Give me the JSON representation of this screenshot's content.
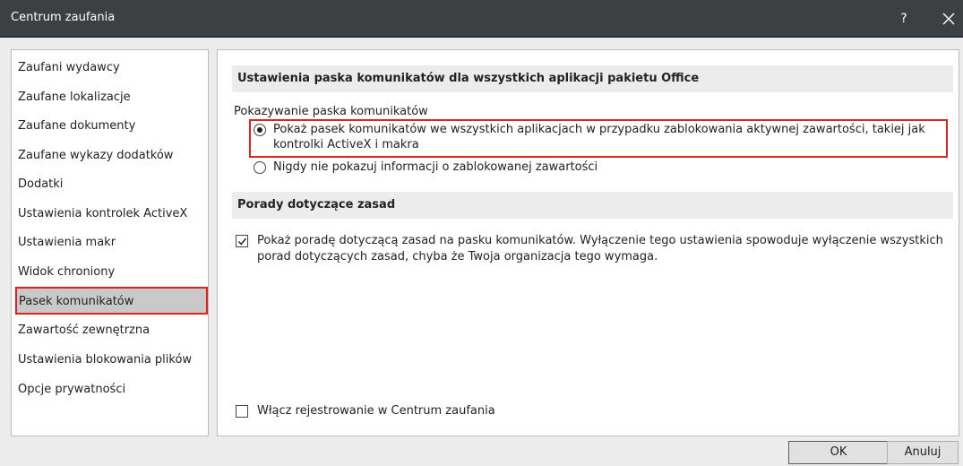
{
  "window": {
    "title": "Centrum zaufania",
    "help_label": "?"
  },
  "sidebar": {
    "items": [
      {
        "label": "Zaufani wydawcy"
      },
      {
        "label": "Zaufane lokalizacje"
      },
      {
        "label": "Zaufane dokumenty"
      },
      {
        "label": "Zaufane wykazy dodatków"
      },
      {
        "label": "Dodatki"
      },
      {
        "label": "Ustawienia kontrolek ActiveX"
      },
      {
        "label": "Ustawienia makr"
      },
      {
        "label": "Widok chroniony"
      },
      {
        "label": "Pasek komunikatów",
        "selected": true
      },
      {
        "label": "Zawartość zewnętrzna"
      },
      {
        "label": "Ustawienia blokowania plików"
      },
      {
        "label": "Opcje prywatności"
      }
    ]
  },
  "message_bar_section": {
    "header": "Ustawienia paska komunikatów dla wszystkich aplikacji pakietu Office",
    "group_label": "Pokazywanie paska komunikatów",
    "option_show_line1": "Pokaż pasek komunikatów we wszystkich aplikacjach w przypadku zablokowania aktywnej zawartości, takiej jak",
    "option_show_line2": "kontrolki ActiveX i makra",
    "option_show_checked": true,
    "option_never": "Nigdy nie pokazuj informacji o zablokowanej zawartości",
    "option_never_checked": false
  },
  "policy_section": {
    "header": "Porady dotyczące zasad",
    "tip_line1": "Pokaż poradę dotyczącą zasad na pasku komunikatów. Wyłączenie tego ustawienia spowoduje wyłączenie wszystkich",
    "tip_line2": "porad dotyczących zasad, chyba że Twoja organizacja tego wymaga.",
    "tip_checked": true
  },
  "logging": {
    "label": "Włącz rejestrowanie w Centrum zaufania",
    "checked": false
  },
  "buttons": {
    "ok": "OK",
    "cancel": "Anuluj"
  },
  "colors": {
    "titlebar": "#3c4043",
    "highlight": "#e0211c",
    "selected_bg": "#c9c9c9",
    "section_bg": "#ececec"
  }
}
